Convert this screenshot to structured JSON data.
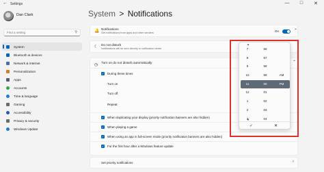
{
  "window": {
    "title": "Settings",
    "minimize": "—",
    "maximize": "□",
    "close": "✕"
  },
  "profile": {
    "name": "Dan Clark"
  },
  "search": {
    "placeholder": "Find a setting"
  },
  "sidebar": {
    "items": [
      {
        "label": "System",
        "icon": "monitor-icon",
        "color": "#0067c0",
        "active": true
      },
      {
        "label": "Bluetooth & devices",
        "icon": "bluetooth-icon",
        "color": "#0067c0"
      },
      {
        "label": "Network & internet",
        "icon": "wifi-icon",
        "color": "#4a6fa5"
      },
      {
        "label": "Personalization",
        "icon": "brush-icon",
        "color": "#d87c2a"
      },
      {
        "label": "Apps",
        "icon": "apps-icon",
        "color": "#5a5a7a"
      },
      {
        "label": "Accounts",
        "icon": "person-icon",
        "color": "#2aa84a"
      },
      {
        "label": "Time & language",
        "icon": "globe-clock-icon",
        "color": "#1b7ad6"
      },
      {
        "label": "Gaming",
        "icon": "controller-icon",
        "color": "#6b6b6b"
      },
      {
        "label": "Accessibility",
        "icon": "accessibility-icon",
        "color": "#1a5fb4"
      },
      {
        "label": "Privacy & security",
        "icon": "shield-icon",
        "color": "#6b6b6b"
      },
      {
        "label": "Windows Update",
        "icon": "update-icon",
        "color": "#1b7ad6"
      }
    ]
  },
  "header": {
    "section": "System",
    "separator": ">",
    "page": "Notifications"
  },
  "notifications": {
    "title": "Notifications",
    "subtitle": "Get notifications from apps and other senders",
    "state": "On"
  },
  "dnd": {
    "title": "Do not disturb",
    "subtitle": "Notifications will be sent directly to notification center",
    "state": "Off"
  },
  "auto": {
    "title": "Turn on do not disturb automatically",
    "during_times": "During these times",
    "turn_on": "Turn on",
    "turn_off": "Turn off",
    "repeat": "Repeat",
    "options": [
      "When duplicating your display (priority notification banners are also hidden)",
      "When playing a game",
      "When using an app in full-screen mode (priority notification banners are also hidden)",
      "For the first hour after a Windows feature update"
    ]
  },
  "priority": {
    "title": "Set priority notifications"
  },
  "picker": {
    "hours": [
      "7",
      "8",
      "9",
      "10",
      "11",
      "12",
      "1",
      "2",
      "3"
    ],
    "minutes": [
      "56",
      "57",
      "58",
      "59",
      "00",
      "01",
      "02",
      "03",
      "04"
    ],
    "periods": [
      "AM",
      "PM"
    ],
    "selected": {
      "hour": "11",
      "minute": "00",
      "period": "PM"
    },
    "accept_glyph": "✓",
    "dismiss_glyph": "✕"
  }
}
